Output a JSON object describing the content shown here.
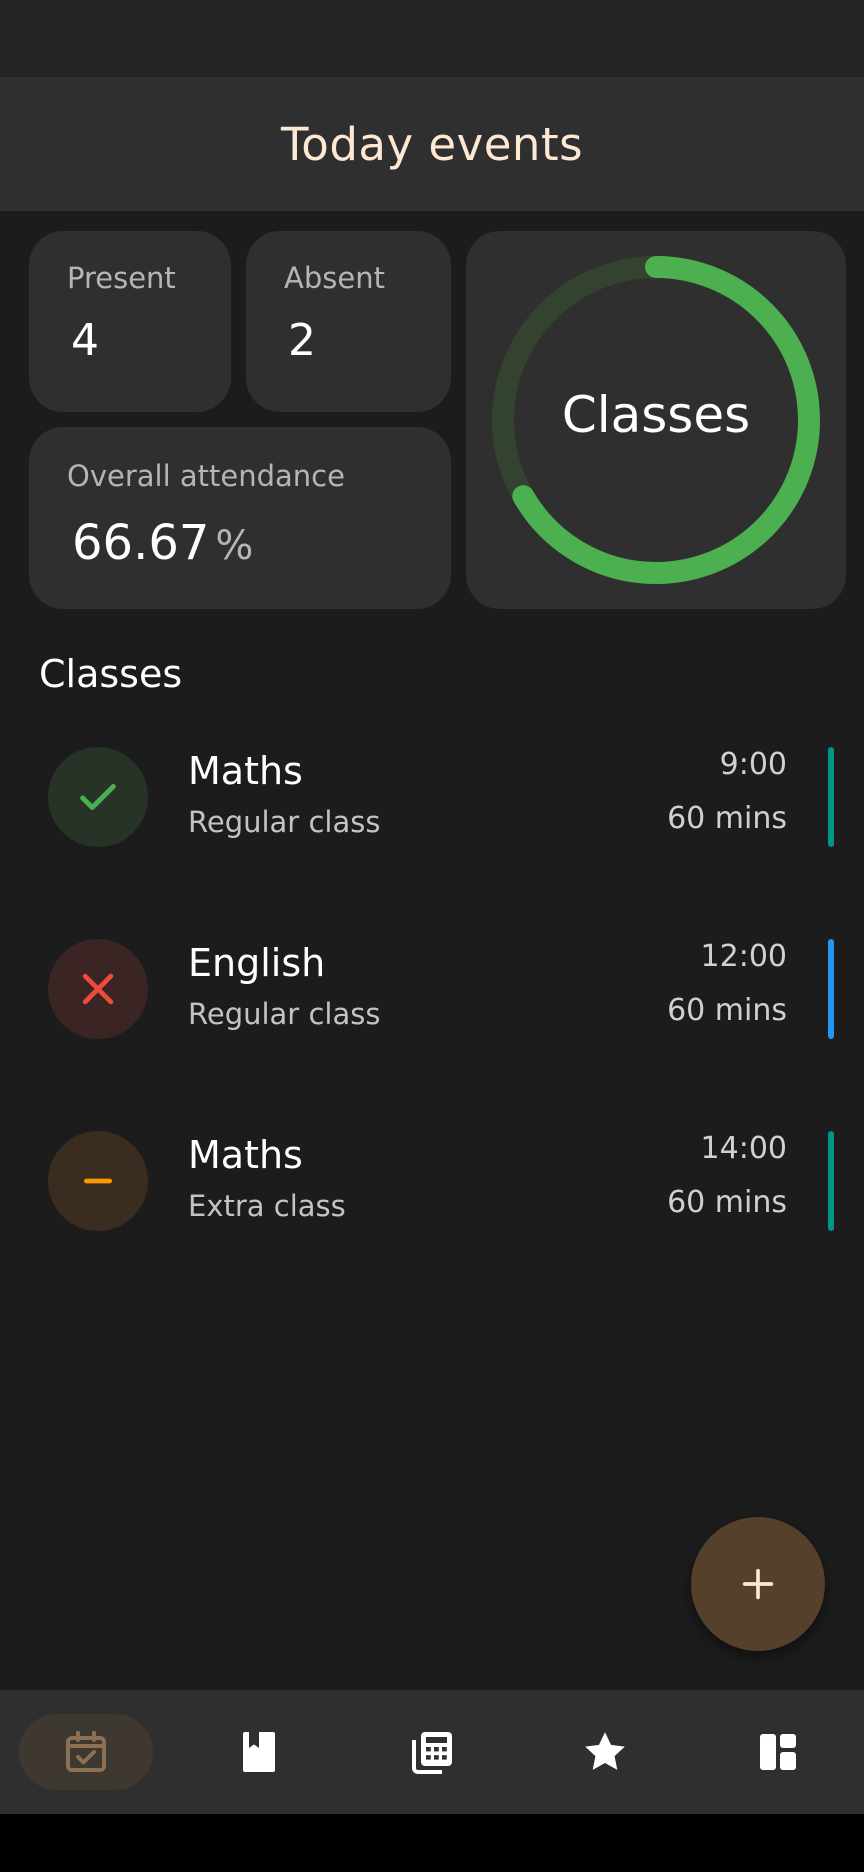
{
  "app": {
    "title": "Today events"
  },
  "stats": {
    "present_label": "Present",
    "present_value": "4",
    "absent_label": "Absent",
    "absent_value": "2",
    "overall_label": "Overall attendance",
    "overall_value": "66.67",
    "overall_unit": "%"
  },
  "ring": {
    "label": "Classes",
    "fraction": 0.6667,
    "color": "#4caf50",
    "track_color": "#34432f"
  },
  "section": {
    "title": "Classes"
  },
  "classes": [
    {
      "name": "Maths",
      "type": "Regular class",
      "time": "9:00",
      "duration": "60 mins",
      "status": "present",
      "status_icon": "check-icon",
      "accent": "#00968a",
      "status_color": "#4caf50",
      "status_bg": "#273327"
    },
    {
      "name": "English",
      "type": "Regular class",
      "time": "12:00",
      "duration": "60 mins",
      "status": "absent",
      "status_icon": "close-icon",
      "accent": "#2196f3",
      "status_color": "#ef4b3a",
      "status_bg": "#3a2424"
    },
    {
      "name": "Maths",
      "type": "Extra class",
      "time": "14:00",
      "duration": "60 mins",
      "status": "cancelled",
      "status_icon": "minus-icon",
      "accent": "#00968a",
      "status_color": "#ff9800",
      "status_bg": "#3a2c1e"
    }
  ],
  "fab": {
    "icon": "plus-icon",
    "color": "#54402b"
  },
  "nav": {
    "items": [
      {
        "icon": "calendar-check-icon",
        "active": true
      },
      {
        "icon": "book-icon",
        "active": false
      },
      {
        "icon": "calculator-icon",
        "active": false
      },
      {
        "icon": "star-icon",
        "active": false
      },
      {
        "icon": "dashboard-icon",
        "active": false
      }
    ]
  }
}
